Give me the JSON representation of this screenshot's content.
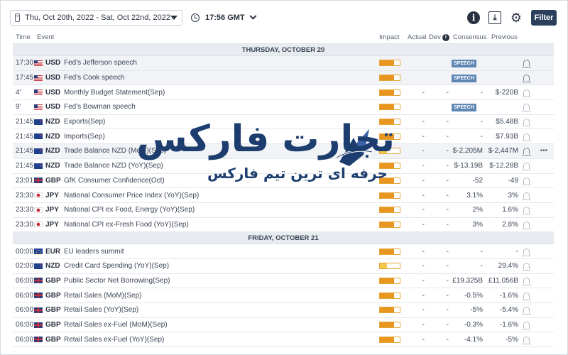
{
  "toolbar": {
    "date_range": "Thu, Oct 20th, 2022 -  Sat, Oct 22nd, 2022",
    "time": "17:56 GMT",
    "filter_label": "Filter",
    "info_glyph": "i",
    "download_glyph": "⤓",
    "gear_glyph": "⚙"
  },
  "columns": {
    "time": "Time",
    "event": "Event",
    "impact": "Impact",
    "actual": "Actual",
    "dev": "Dev",
    "consensus": "Consensus",
    "previous": "Previous"
  },
  "days": [
    {
      "label": "THURSDAY, OCTOBER 20",
      "rows": [
        {
          "time": "17:30",
          "currency": "USD",
          "event": "Fed's Jefferson speech",
          "impact": 0.7,
          "low": false,
          "actual": "",
          "dev": "",
          "consensus": "",
          "badge": "SPEECH",
          "previous": "",
          "bell_dark": true,
          "alt": true,
          "more": ""
        },
        {
          "time": "17:45",
          "currency": "USD",
          "event": "Fed's Cook speech",
          "impact": 0.7,
          "low": false,
          "actual": "",
          "dev": "",
          "consensus": "",
          "badge": "SPEECH",
          "previous": "",
          "bell_dark": true,
          "alt": true,
          "more": ""
        },
        {
          "time": "4'",
          "currency": "USD",
          "event": "Monthly Budget Statement(Sep)",
          "impact": 0.7,
          "low": false,
          "actual": "-",
          "dev": "-",
          "consensus": "-",
          "badge": "",
          "previous": "$-220B",
          "bell_dark": false,
          "alt": false,
          "more": ""
        },
        {
          "time": "9'",
          "currency": "USD",
          "event": "Fed's Bowman speech",
          "impact": 0.7,
          "low": false,
          "actual": "",
          "dev": "",
          "consensus": "",
          "badge": "SPEECH",
          "previous": "",
          "bell_dark": false,
          "alt": false,
          "more": ""
        },
        {
          "time": "21:45",
          "currency": "NZD",
          "event": "Exports(Sep)",
          "impact": 0.7,
          "low": false,
          "actual": "-",
          "dev": "-",
          "consensus": "-",
          "badge": "",
          "previous": "$5.48B",
          "bell_dark": false,
          "alt": false,
          "more": ""
        },
        {
          "time": "21:45",
          "currency": "NZD",
          "event": "Imports(Sep)",
          "impact": 0.7,
          "low": false,
          "actual": "-",
          "dev": "-",
          "consensus": "-",
          "badge": "",
          "previous": "$7.93B",
          "bell_dark": false,
          "alt": false,
          "more": ""
        },
        {
          "time": "21:45",
          "currency": "NZD",
          "event": "Trade Balance NZD (MoM)(Sep)",
          "impact": 0.35,
          "low": true,
          "actual": "-",
          "dev": "-",
          "consensus": "$-2,205M",
          "badge": "",
          "previous": "$-2,447M",
          "bell_dark": true,
          "alt": true,
          "more": "•••"
        },
        {
          "time": "21:45",
          "currency": "NZD",
          "event": "Trade Balance NZD (YoY)(Sep)",
          "impact": 0.7,
          "low": false,
          "actual": "-",
          "dev": "-",
          "consensus": "$-13.19B",
          "badge": "",
          "previous": "$-12.28B",
          "bell_dark": false,
          "alt": false,
          "more": ""
        },
        {
          "time": "23:01",
          "currency": "GBP",
          "event": "GfK Consumer Confidence(Oct)",
          "impact": 0.7,
          "low": false,
          "actual": "-",
          "dev": "-",
          "consensus": "-52",
          "badge": "",
          "previous": "-49",
          "bell_dark": false,
          "alt": false,
          "more": ""
        },
        {
          "time": "23:30",
          "currency": "JPY",
          "event": "National Consumer Price Index (YoY)(Sep)",
          "impact": 0.7,
          "low": false,
          "actual": "-",
          "dev": "-",
          "consensus": "3.1%",
          "badge": "",
          "previous": "3%",
          "bell_dark": false,
          "alt": false,
          "more": ""
        },
        {
          "time": "23:30",
          "currency": "JPY",
          "event": "National CPI ex Food, Energy (YoY)(Sep)",
          "impact": 0.7,
          "low": false,
          "actual": "-",
          "dev": "-",
          "consensus": "2%",
          "badge": "",
          "previous": "1.6%",
          "bell_dark": false,
          "alt": false,
          "more": ""
        },
        {
          "time": "23:30",
          "currency": "JPY",
          "event": "National CPI ex-Fresh Food (YoY)(Sep)",
          "impact": 0.7,
          "low": false,
          "actual": "-",
          "dev": "-",
          "consensus": "3%",
          "badge": "",
          "previous": "2.8%",
          "bell_dark": false,
          "alt": false,
          "more": ""
        }
      ]
    },
    {
      "label": "FRIDAY, OCTOBER 21",
      "rows": [
        {
          "time": "00:00",
          "currency": "EUR",
          "event": "EU leaders summit",
          "impact": 0.7,
          "low": false,
          "actual": "-",
          "dev": "-",
          "consensus": "-",
          "badge": "",
          "previous": "-",
          "bell_dark": false,
          "alt": false,
          "more": ""
        },
        {
          "time": "02:00",
          "currency": "NZD",
          "event": "Credit Card Spending (YoY)(Sep)",
          "impact": 0.35,
          "low": true,
          "actual": "-",
          "dev": "-",
          "consensus": "-",
          "badge": "",
          "previous": "29.4%",
          "bell_dark": false,
          "alt": false,
          "more": ""
        },
        {
          "time": "06:00",
          "currency": "GBP",
          "event": "Public Sector Net Borrowing(Sep)",
          "impact": 0.7,
          "low": false,
          "actual": "-",
          "dev": "-",
          "consensus": "£19.325B",
          "badge": "",
          "previous": "£11.056B",
          "bell_dark": false,
          "alt": false,
          "more": ""
        },
        {
          "time": "06:00",
          "currency": "GBP",
          "event": "Retail Sales (MoM)(Sep)",
          "impact": 0.7,
          "low": false,
          "actual": "-",
          "dev": "-",
          "consensus": "-0.5%",
          "badge": "",
          "previous": "-1.6%",
          "bell_dark": false,
          "alt": false,
          "more": ""
        },
        {
          "time": "06:00",
          "currency": "GBP",
          "event": "Retail Sales (YoY)(Sep)",
          "impact": 0.7,
          "low": false,
          "actual": "-",
          "dev": "-",
          "consensus": "-5%",
          "badge": "",
          "previous": "-5.4%",
          "bell_dark": false,
          "alt": false,
          "more": ""
        },
        {
          "time": "06:00",
          "currency": "GBP",
          "event": "Retail Sales ex-Fuel (MoM)(Sep)",
          "impact": 0.7,
          "low": false,
          "actual": "-",
          "dev": "-",
          "consensus": "-0.3%",
          "badge": "",
          "previous": "-1.6%",
          "bell_dark": false,
          "alt": false,
          "more": ""
        },
        {
          "time": "06:00",
          "currency": "GBP",
          "event": "Retail Sales ex-Fuel (YoY)(Sep)",
          "impact": 0.7,
          "low": false,
          "actual": "-",
          "dev": "-",
          "consensus": "-4.1%",
          "badge": "",
          "previous": "-5%",
          "bell_dark": false,
          "alt": false,
          "more": ""
        }
      ]
    }
  ],
  "watermark": {
    "title": "تجارت فارکس",
    "subtitle": "حرفه ای ترین تیم فارکس"
  }
}
